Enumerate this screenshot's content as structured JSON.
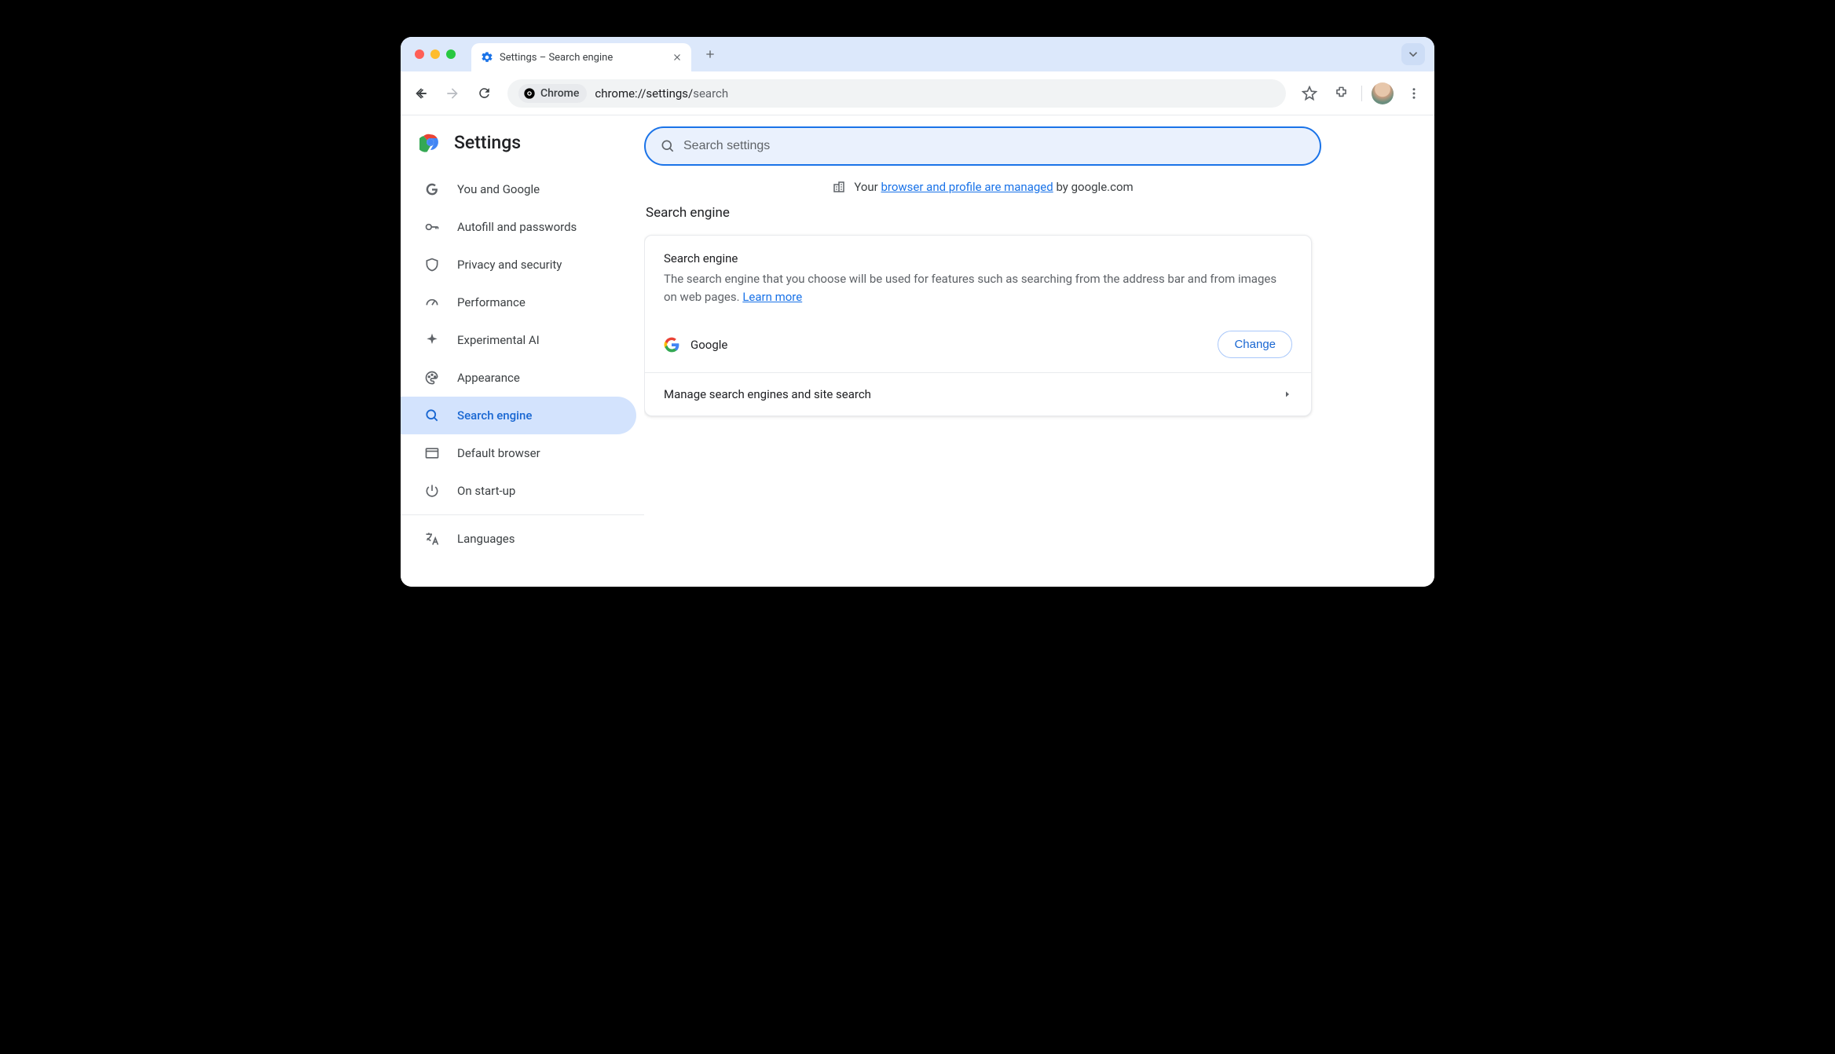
{
  "tab": {
    "title": "Settings – Search engine"
  },
  "omnibox": {
    "chip_label": "Chrome",
    "url_prefix": "chrome://settings/",
    "url_path": "search"
  },
  "sidebar": {
    "title": "Settings",
    "items": [
      {
        "label": "You and Google"
      },
      {
        "label": "Autofill and passwords"
      },
      {
        "label": "Privacy and security"
      },
      {
        "label": "Performance"
      },
      {
        "label": "Experimental AI"
      },
      {
        "label": "Appearance"
      },
      {
        "label": "Search engine"
      },
      {
        "label": "Default browser"
      },
      {
        "label": "On start-up"
      }
    ],
    "items2": [
      {
        "label": "Languages"
      }
    ]
  },
  "search": {
    "placeholder": "Search settings"
  },
  "managed": {
    "prefix": "Your ",
    "link": "browser and profile are managed",
    "suffix": " by google.com"
  },
  "section": {
    "title": "Search engine"
  },
  "card": {
    "subtitle": "Search engine",
    "description": "The search engine that you choose will be used for features such as searching from the address bar and from images on web pages. ",
    "learn_more": "Learn more",
    "selected_engine": "Google",
    "change_label": "Change",
    "manage_label": "Manage search engines and site search"
  }
}
